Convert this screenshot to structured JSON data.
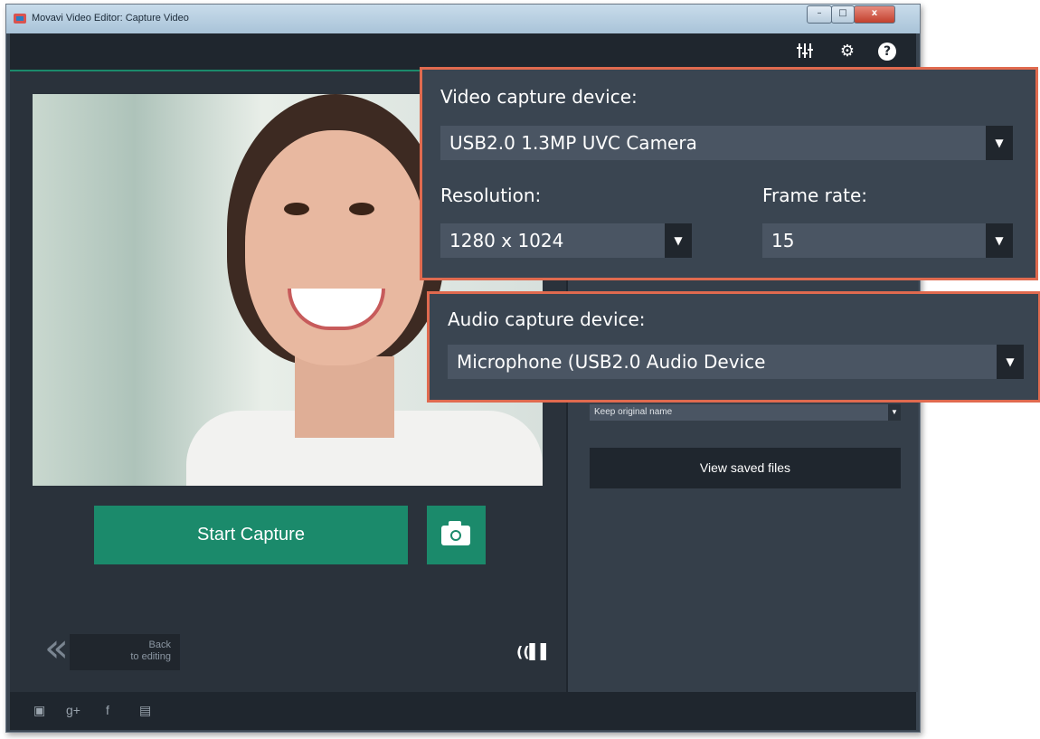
{
  "window": {
    "title": "Movavi Video Editor: Capture Video",
    "controls": {
      "minimize": "–",
      "maximize": "□",
      "close": "x"
    }
  },
  "toolbar": {
    "icons": [
      "equalizer-icon",
      "gear-icon",
      "help-icon"
    ],
    "help_glyph": "?"
  },
  "main": {
    "start_capture_label": "Start Capture",
    "snapshot_icon": "camera-icon",
    "back": {
      "line1": "Back",
      "line2": "to editing"
    },
    "audio_meter_icon": "audio-level-icon"
  },
  "right_panel": {
    "file_name_select": "Keep original name",
    "view_saved_files_label": "View saved files"
  },
  "video_settings": {
    "device_label": "Video capture device:",
    "device_value": "USB2.0 1.3MP UVC Camera",
    "resolution_label": "Resolution:",
    "resolution_value": "1280 x 1024",
    "frame_rate_label": "Frame rate:",
    "frame_rate_value": "15"
  },
  "audio_settings": {
    "device_label": "Audio capture device:",
    "device_value": "Microphone (USB2.0 Audio Device"
  },
  "footer": {
    "social_icons": [
      "youtube-icon",
      "google-plus-icon",
      "facebook-icon",
      "vk-icon"
    ]
  },
  "colors": {
    "accent": "#1b8a6b",
    "callout_border": "#e06a4f",
    "panel": "#3a4551"
  }
}
